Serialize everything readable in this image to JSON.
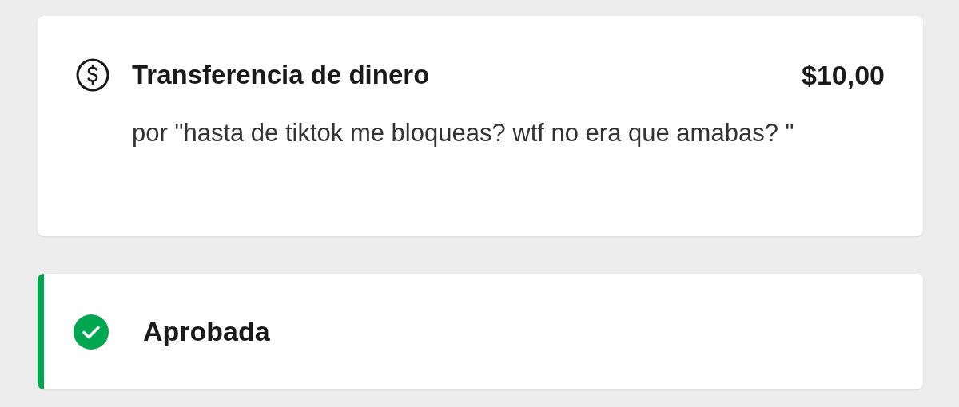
{
  "transaction": {
    "title": "Transferencia de dinero",
    "amount": "$10,00",
    "description": "por \"hasta de tiktok me bloqueas? wtf no era que amabas? \""
  },
  "status": {
    "kind": "approved",
    "label": "Aprobada"
  }
}
